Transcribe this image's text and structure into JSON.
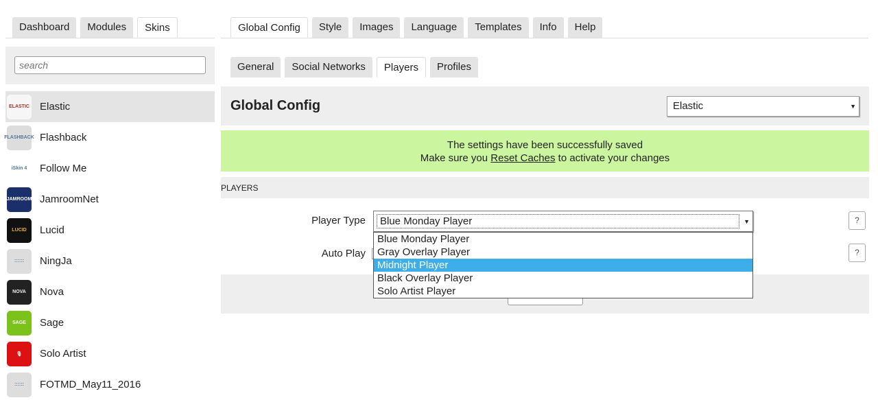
{
  "left_tabs": [
    "Dashboard",
    "Modules",
    "Skins"
  ],
  "right_tabs": [
    "Global Config",
    "Style",
    "Images",
    "Language",
    "Templates",
    "Info",
    "Help"
  ],
  "sub_tabs": [
    "General",
    "Social Networks",
    "Players",
    "Profiles"
  ],
  "search": {
    "placeholder": "search"
  },
  "skins": [
    {
      "name": "Elastic",
      "icon": "elastic-logo",
      "color": "#f6f6f6",
      "fg": "#a33",
      "txt": "ELASTIC"
    },
    {
      "name": "Flashback",
      "icon": "flashback-logo",
      "color": "#ddd",
      "fg": "#579",
      "txt": "FLASHBACK"
    },
    {
      "name": "Follow Me",
      "icon": "followme-logo",
      "color": "#fff",
      "fg": "#579",
      "txt": "iSkin 4"
    },
    {
      "name": "JamroomNet",
      "icon": "jamroomnet-logo",
      "color": "#1b2f6b",
      "fg": "#fff",
      "txt": "JAMROOM"
    },
    {
      "name": "Lucid",
      "icon": "lucid-logo",
      "color": "#111",
      "fg": "#e5b022",
      "txt": "LUCID"
    },
    {
      "name": "NingJa",
      "icon": "ningja-logo",
      "color": "#ddd",
      "fg": "#579",
      "txt": "::::::"
    },
    {
      "name": "Nova",
      "icon": "nova-logo",
      "color": "#222",
      "fg": "#eee",
      "txt": "NOVA"
    },
    {
      "name": "Sage",
      "icon": "sage-logo",
      "color": "#7bc21a",
      "fg": "#fff",
      "txt": "SAGE"
    },
    {
      "name": "Solo Artist",
      "icon": "microphone-logo",
      "color": "#d11",
      "fg": "#fff",
      "txt": "🎙"
    },
    {
      "name": "FOTMD_May11_2016",
      "icon": "fotmd-logo",
      "color": "#ddd",
      "fg": "#579",
      "txt": "::::::"
    }
  ],
  "header": {
    "title": "Global Config",
    "skin_select": "Elastic"
  },
  "notice": {
    "line1": "The settings have been successfully saved",
    "line2_pre": "Make sure you ",
    "link": "Reset Caches",
    "line2_post": " to activate your changes",
    "bg": "#ccf5a0"
  },
  "section": {
    "title": "PLAYERS"
  },
  "form": {
    "player_type_label": "Player Type",
    "player_type_value": "Blue Monday Player",
    "auto_play_label": "Auto Play",
    "help": "?"
  },
  "dropdown_options": [
    "Blue Monday Player",
    "Gray Overlay Player",
    "Midnight Player",
    "Black Overlay Player",
    "Solo Artist Player"
  ],
  "highlighted_option": 2
}
